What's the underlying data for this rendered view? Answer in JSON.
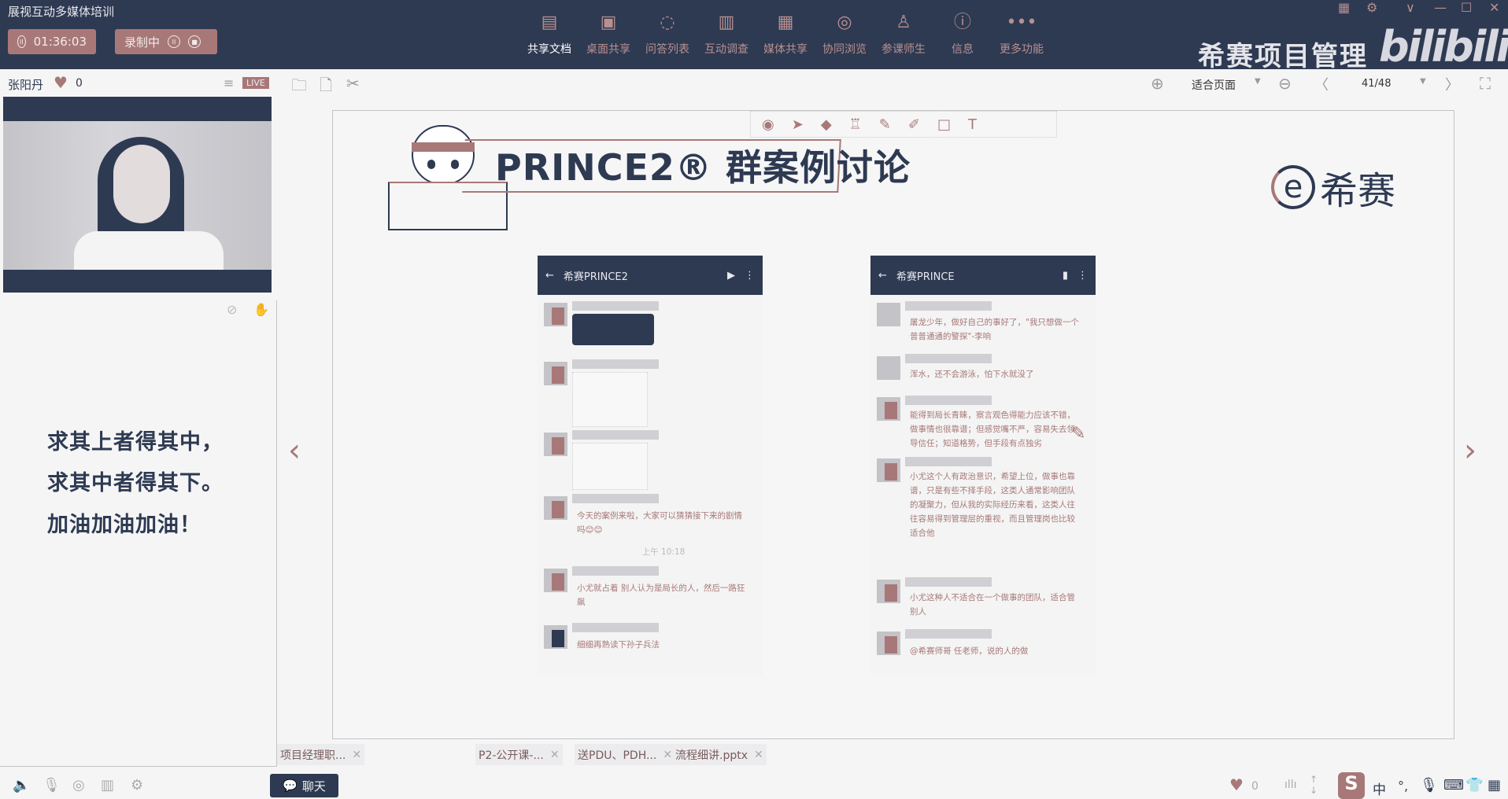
{
  "app": {
    "title": "展视互动多媒体培训",
    "timer": "01:36:03",
    "recording_label": "录制中"
  },
  "toolbar": [
    {
      "label": "共享文档",
      "icon": "document-icon",
      "glyph": "▤"
    },
    {
      "label": "桌面共享",
      "icon": "desktop-icon",
      "glyph": "▣"
    },
    {
      "label": "问答列表",
      "icon": "qa-icon",
      "glyph": "◌"
    },
    {
      "label": "互动调查",
      "icon": "chart-icon",
      "glyph": "▥"
    },
    {
      "label": "媒体共享",
      "icon": "film-icon",
      "glyph": "▦"
    },
    {
      "label": "协同浏览",
      "icon": "compass-icon",
      "glyph": "◎"
    },
    {
      "label": "参课师生",
      "icon": "users-icon",
      "glyph": "♙"
    },
    {
      "label": "信息",
      "icon": "info-icon",
      "glyph": "ⓘ"
    },
    {
      "label": "更多功能",
      "icon": "more-icon",
      "glyph": "•••"
    }
  ],
  "brand": {
    "text": "希赛项目管理",
    "watermark": "bilibili"
  },
  "presenter": {
    "name": "张阳丹",
    "likes": "0",
    "live": "LIVE"
  },
  "doc_controls": {
    "zoom_mode": "适合页面",
    "page": "41/48"
  },
  "motto": [
    "求其上者得其中，",
    "求其中者得其下。",
    "加油加油加油！"
  ],
  "slide": {
    "title": "PRINCE2® 群案例讨论",
    "logo": "希赛",
    "left_chat": {
      "header": "希赛PRINCE2",
      "time": "上午 10:18",
      "messages": [
        "今天的案例来啦，大家可以猜猜接下来的剧情吗😊😊",
        "小尤就占着 别人认为是局长的人，然后一路狂飙",
        "细细再熟读下孙子兵法"
      ]
    },
    "right_chat": {
      "header": "希赛PRINCE",
      "messages": [
        "屠龙少年，做好自己的事好了，\"我只想做一个普普通通的警探\"-李响",
        "浑水，还不会游泳，怕下水就没了",
        "能得到局长青睐，察言观色得能力应该不错，做事情也很靠谱；但感觉嘴不严，容易失去领导信任；知道格势，但手段有点独劣",
        "小尤这个人有政治意识，希望上位，做事也靠谱，只是有些不择手段，这类人通常影响团队的凝聚力，但从我的实际经历来看，这类人往往容易得到管理层的重视，而且管理岗也比较适合他",
        "小尤这种人不适合在一个做事的团队，适合管别人",
        "@希赛师哥 任老师，说的人的做"
      ]
    }
  },
  "tabs": [
    "项目经理职...",
    "P2-公开课-...",
    "送PDU、PDH...",
    "流程细讲.pptx"
  ],
  "bottom": {
    "chat_label": "聊天",
    "likes": "0",
    "ime": "中"
  }
}
